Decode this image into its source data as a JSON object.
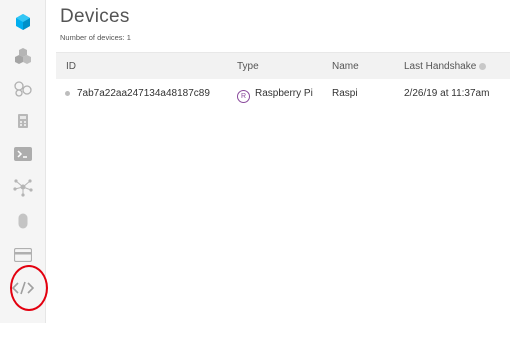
{
  "sidebar": {
    "items": [
      {
        "name": "particle-logo-icon"
      },
      {
        "name": "products-icon"
      },
      {
        "name": "integrations-icon"
      },
      {
        "name": "console-icon"
      },
      {
        "name": "terminal-icon"
      },
      {
        "name": "mesh-network-icon"
      },
      {
        "name": "sim-card-icon"
      },
      {
        "name": "billing-icon"
      },
      {
        "name": "code-icon"
      }
    ]
  },
  "page": {
    "title": "Devices",
    "subtitle": "Number of devices: 1"
  },
  "table": {
    "headers": {
      "id": "ID",
      "type": "Type",
      "name": "Name",
      "last_handshake": "Last Handshake"
    },
    "rows": [
      {
        "id": "7ab7a22aa247134a48187c89",
        "type_badge": "R",
        "type": "Raspberry Pi",
        "name": "Raspi",
        "last_handshake": "2/26/19 at 11:37am"
      }
    ]
  },
  "colors": {
    "accent": "#00aeef",
    "badge": "#8a4a9c",
    "annotation": "#e3000f"
  }
}
